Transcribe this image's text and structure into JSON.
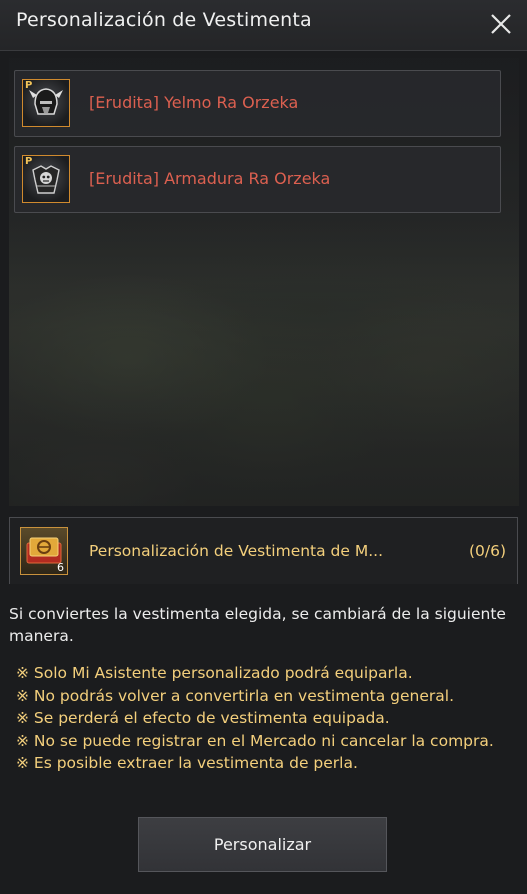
{
  "window": {
    "title": "Personalización de Vestimenta",
    "close_icon": "close-icon"
  },
  "items": [
    {
      "name": "[Erudita] Yelmo Ra Orzeka",
      "badge": "P",
      "icon": "helmet-icon"
    },
    {
      "name": "[Erudita] Armadura Ra Orzeka",
      "badge": "P",
      "icon": "armor-icon"
    }
  ],
  "coupon": {
    "icon": "ticket-icon",
    "count": "6",
    "name": "Personalización de Vestimenta de M...",
    "quantity": "(0/6)"
  },
  "description": "Si conviertes la vestimenta elegida, se cambiará de la siguiente manera.",
  "notes": [
    "※ Solo Mi Asistente personalizado podrá equiparla.",
    "※ No podrás volver a convertirla en vestimenta general.",
    "※ Se perderá el efecto de vestimenta equipada.",
    "※ No se puede registrar en el Mercado ni cancelar la compra.",
    "※ Es posible extraer la vestimenta de perla."
  ],
  "actions": {
    "customize_label": "Personalizar"
  },
  "colors": {
    "item_name": "#dc6050",
    "highlight": "#f3cf7c",
    "icon_border": "#d08a2e"
  }
}
